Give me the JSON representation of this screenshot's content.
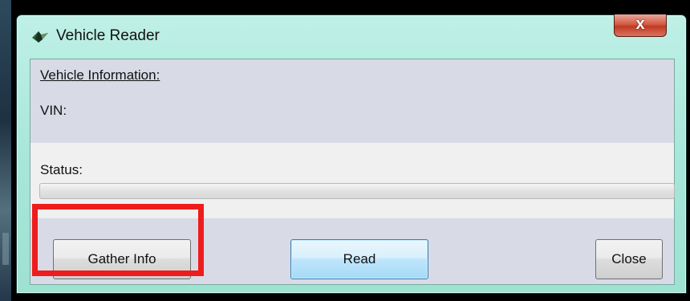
{
  "window": {
    "title": "Vehicle Reader",
    "close_glyph": "x",
    "icon": "app-icon"
  },
  "vehicle_info": {
    "heading": "Vehicle Information:",
    "vin_label": "VIN:",
    "vin_value": ""
  },
  "status": {
    "label": "Status:",
    "progress": 0
  },
  "buttons": {
    "gather_info": "Gather Info",
    "read": "Read",
    "close": "Close"
  },
  "annotation": {
    "highlight_target": "gather-info-button",
    "color": "#ee1c1c"
  },
  "colors": {
    "frame": "#a6e6d8",
    "panel": "#d8dbe6",
    "client": "#f0f0f0",
    "close_button": "#c03a23",
    "default_button_border": "#3c7fb1"
  }
}
